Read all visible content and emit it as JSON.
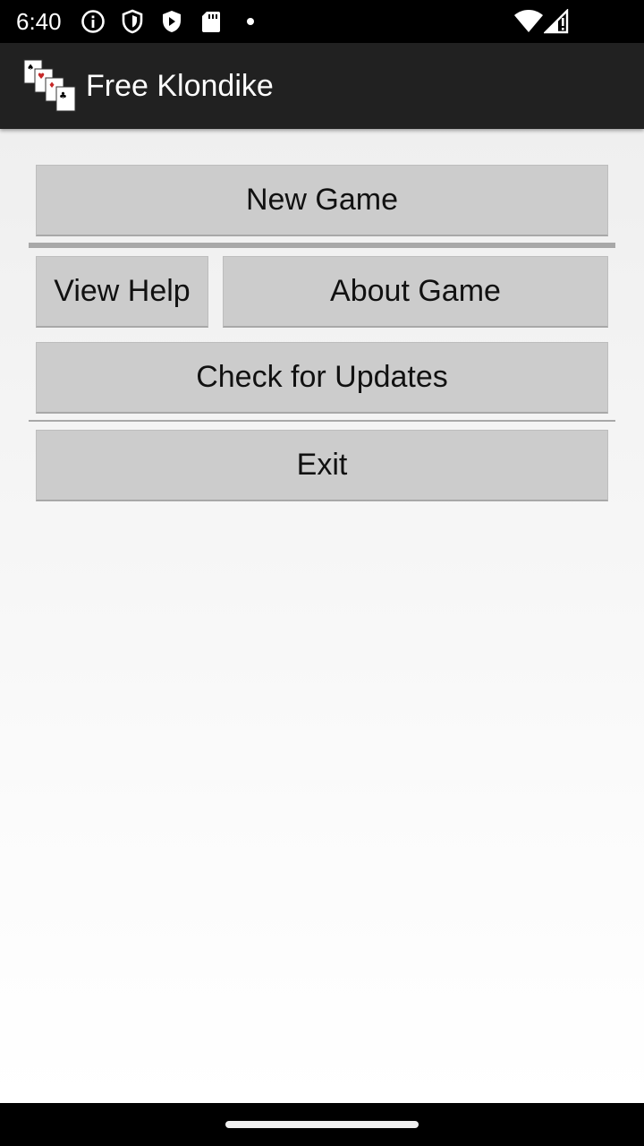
{
  "status_bar": {
    "time": "6:40",
    "icons": [
      "info-icon",
      "shield-icon",
      "vpn-shield-icon",
      "sd-card-icon",
      "notification-dot",
      "wifi-icon",
      "cell-signal-icon"
    ]
  },
  "app_bar": {
    "title": "Free Klondike",
    "icon": "playing-cards-icon"
  },
  "menu": {
    "new_game": "New Game",
    "view_help": "View Help",
    "about_game": "About Game",
    "check_updates": "Check for Updates",
    "exit": "Exit"
  },
  "colors": {
    "status_bar_bg": "#000000",
    "app_bar_bg": "#212121",
    "button_bg": "#cccccc",
    "divider": "#a8a8a8"
  }
}
